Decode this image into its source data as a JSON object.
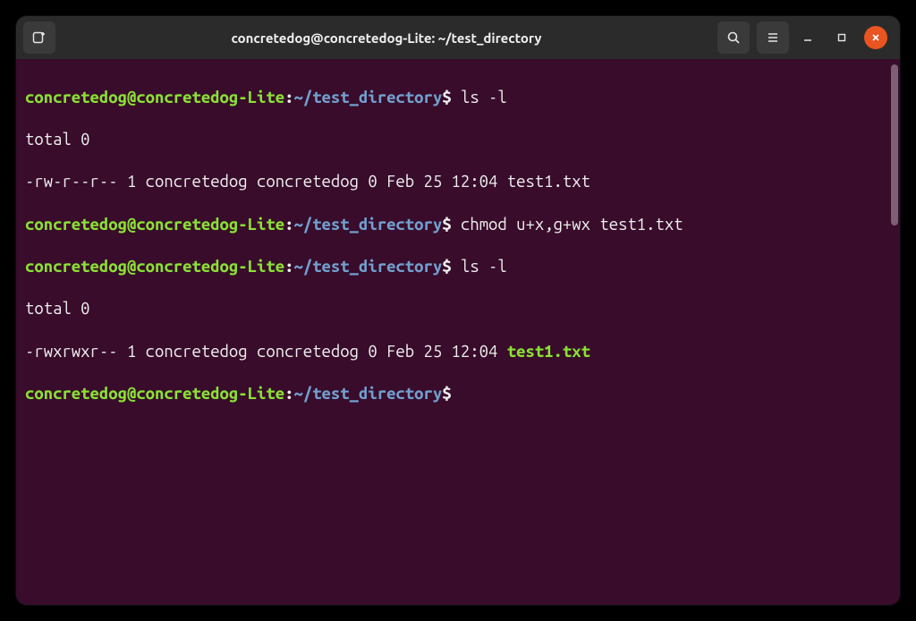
{
  "window": {
    "title": "concretedog@concretedog-Lite: ~/test_directory"
  },
  "prompt": {
    "user_host": "concretedog@concretedog-Lite",
    "sep": ":",
    "path": "~/test_directory",
    "symbol": "$"
  },
  "session": {
    "cmd1": " ls -l",
    "out1_total": "total 0",
    "out1_entry": "-rw-r--r-- 1 concretedog concretedog 0 Feb 25 12:04 test1.txt",
    "cmd2": " chmod u+x,g+wx test1.txt",
    "cmd3": " ls -l",
    "out3_total": "total 0",
    "out3_entry_perms": "-rwxrwxr-- 1 concretedog concretedog 0 Feb 25 12:04 ",
    "out3_entry_file": "test1.txt"
  }
}
